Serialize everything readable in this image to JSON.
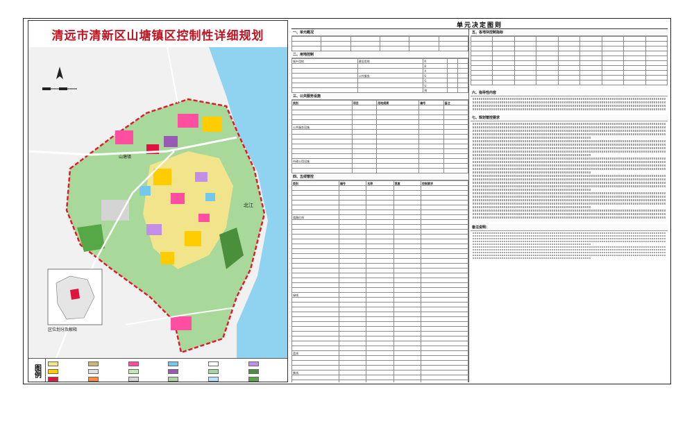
{
  "left_panel": {
    "title": "清远市清新区山塘镇区控制性详细规划",
    "river_label": "北江",
    "town_label": "山塘镇",
    "inset_title": "区位划分及解释",
    "legend_title": "图例",
    "legend_items": [
      {
        "label": "",
        "color": "#f1e48a"
      },
      {
        "label": "",
        "color": "#c9b77a"
      },
      {
        "label": "",
        "color": "#ff4fa0"
      },
      {
        "label": "",
        "color": "#74c8ec"
      },
      {
        "label": "",
        "color": "#ffffff"
      },
      {
        "label": "",
        "color": "#c18fe8"
      },
      {
        "label": "",
        "color": "#ffcc00"
      },
      {
        "label": "",
        "color": "#e0e0e0"
      },
      {
        "label": "",
        "color": "#c3e8b4"
      },
      {
        "label": "",
        "color": "#9b59b6"
      },
      {
        "label": "",
        "color": "#9fd89a"
      },
      {
        "label": "",
        "color": "#4a8f3c"
      },
      {
        "label": "",
        "color": "#e0123e"
      },
      {
        "label": "",
        "color": "#ff8a3d"
      },
      {
        "label": "",
        "color": "#d4d4d4"
      },
      {
        "label": "",
        "color": "#a8d99a"
      },
      {
        "label": "",
        "color": "#b5e6ff"
      },
      {
        "label": "",
        "color": "#55a845"
      }
    ]
  },
  "right_panel": {
    "title": "单元决定图则",
    "col_a": {
      "sec_basic": "一、单元概况",
      "sec_land": "二、用地控制",
      "land_rows": [
        {
          "c1": "城乡用地",
          "c2": "建设用地",
          "c3": "R",
          "c4": "",
          "c5": ""
        },
        {
          "c1": "",
          "c2": "",
          "c3": "B",
          "c4": "",
          "c5": ""
        },
        {
          "c1": "",
          "c2": "",
          "c3": "A",
          "c4": "",
          "c5": ""
        },
        {
          "c1": "",
          "c2": "公共服务",
          "c3": "S",
          "c4": "",
          "c5": ""
        },
        {
          "c1": "",
          "c2": "",
          "c3": "G",
          "c4": "",
          "c5": ""
        },
        {
          "c1": "",
          "c2": "",
          "c3": "U",
          "c4": "",
          "c5": ""
        },
        {
          "c1": "",
          "c2": "",
          "c3": "W",
          "c4": "",
          "c5": ""
        }
      ],
      "sec_service": "三、公共服务设施",
      "service_header": [
        "类别",
        "项目",
        "用地规模",
        "编号",
        "备注"
      ],
      "service_group_1": "公共服务设施",
      "service_group_2": "市政公用设施",
      "sec_five": "四、五线管控",
      "five_header": [
        "类别",
        "编号",
        "名称",
        "宽度",
        "控制要求"
      ],
      "five_group_1": "道路红线",
      "five_group_2": "绿线",
      "five_group_3": "蓝线",
      "five_group_4": "紫线"
    },
    "col_b": {
      "sec_indicator": "五、各地块控制指标",
      "sec_fixed": "六、指导性内容",
      "sec_guidance": "七、规划管控要求",
      "sec_notes": "备注说明："
    }
  }
}
